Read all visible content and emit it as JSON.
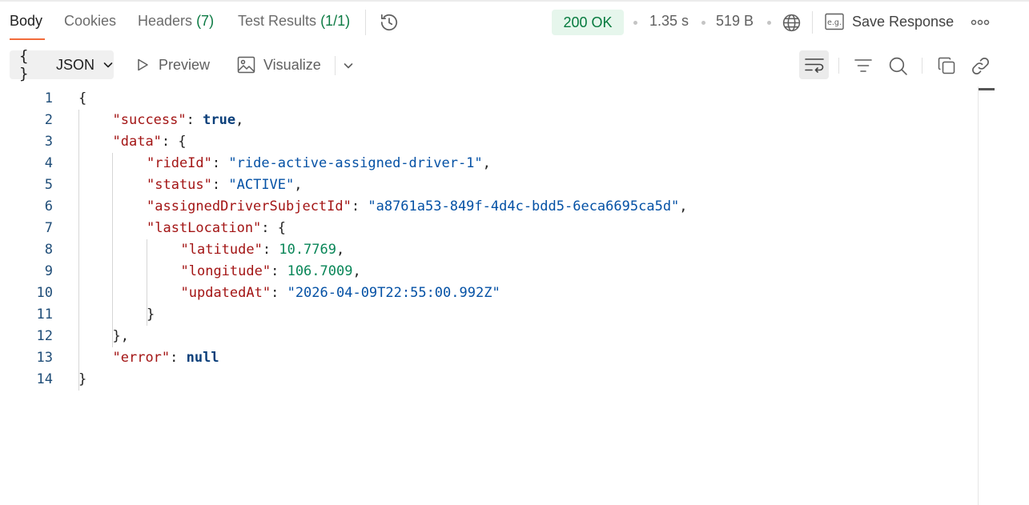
{
  "tabs": {
    "body": "Body",
    "cookies": "Cookies",
    "headers": "Headers",
    "headers_count": "(7)",
    "test_results": "Test Results",
    "test_results_count": "(1/1)"
  },
  "response": {
    "status": "200 OK",
    "time": "1.35 s",
    "size": "519 B",
    "save_label": "Save Response"
  },
  "toolbar": {
    "format_braces": "{ }",
    "format_label": "JSON",
    "preview_label": "Preview",
    "visualize_label": "Visualize"
  },
  "icons": {
    "history": "history-icon",
    "network": "globe-icon",
    "save": "example-icon",
    "more": "more-horizontal-icon",
    "wrap": "word-wrap-icon",
    "filter": "filter-icon",
    "search": "search-icon",
    "copy": "copy-icon",
    "link": "link-icon"
  },
  "colors": {
    "accent": "#f26b3a",
    "status_bg": "#e6f6ec",
    "status_text": "#067a3e",
    "json_key": "#a31515",
    "json_string": "#0451a5",
    "json_number": "#098658",
    "json_keyword": "#0b3f7a"
  },
  "code": {
    "lines": [
      {
        "num": "1",
        "parts": [
          {
            "t": "{",
            "c": "punct"
          }
        ]
      },
      {
        "num": "2",
        "parts": [
          {
            "t": "\"success\"",
            "c": "key"
          },
          {
            "t": ": ",
            "c": "punct"
          },
          {
            "t": "true",
            "c": "kw"
          },
          {
            "t": ",",
            "c": "punct"
          }
        ]
      },
      {
        "num": "3",
        "parts": [
          {
            "t": "\"data\"",
            "c": "key"
          },
          {
            "t": ": {",
            "c": "punct"
          }
        ]
      },
      {
        "num": "4",
        "parts": [
          {
            "t": "\"rideId\"",
            "c": "key"
          },
          {
            "t": ": ",
            "c": "punct"
          },
          {
            "t": "\"ride-active-assigned-driver-1\"",
            "c": "str"
          },
          {
            "t": ",",
            "c": "punct"
          }
        ]
      },
      {
        "num": "5",
        "parts": [
          {
            "t": "\"status\"",
            "c": "key"
          },
          {
            "t": ": ",
            "c": "punct"
          },
          {
            "t": "\"ACTIVE\"",
            "c": "str"
          },
          {
            "t": ",",
            "c": "punct"
          }
        ]
      },
      {
        "num": "6",
        "parts": [
          {
            "t": "\"assignedDriverSubjectId\"",
            "c": "key"
          },
          {
            "t": ": ",
            "c": "punct"
          },
          {
            "t": "\"a8761a53-849f-4d4c-bdd5-6eca6695ca5d\"",
            "c": "str"
          },
          {
            "t": ",",
            "c": "punct"
          }
        ]
      },
      {
        "num": "7",
        "parts": [
          {
            "t": "\"lastLocation\"",
            "c": "key"
          },
          {
            "t": ": {",
            "c": "punct"
          }
        ]
      },
      {
        "num": "8",
        "parts": [
          {
            "t": "\"latitude\"",
            "c": "key"
          },
          {
            "t": ": ",
            "c": "punct"
          },
          {
            "t": "10.7769",
            "c": "num"
          },
          {
            "t": ",",
            "c": "punct"
          }
        ]
      },
      {
        "num": "9",
        "parts": [
          {
            "t": "\"longitude\"",
            "c": "key"
          },
          {
            "t": ": ",
            "c": "punct"
          },
          {
            "t": "106.7009",
            "c": "num"
          },
          {
            "t": ",",
            "c": "punct"
          }
        ]
      },
      {
        "num": "10",
        "parts": [
          {
            "t": "\"updatedAt\"",
            "c": "key"
          },
          {
            "t": ": ",
            "c": "punct"
          },
          {
            "t": "\"2026-04-09T22:55:00.992Z\"",
            "c": "str"
          }
        ]
      },
      {
        "num": "11",
        "parts": [
          {
            "t": "}",
            "c": "punct"
          }
        ]
      },
      {
        "num": "12",
        "parts": [
          {
            "t": "},",
            "c": "punct"
          }
        ]
      },
      {
        "num": "13",
        "parts": [
          {
            "t": "\"error\"",
            "c": "key"
          },
          {
            "t": ": ",
            "c": "punct"
          },
          {
            "t": "null",
            "c": "kw"
          }
        ]
      },
      {
        "num": "14",
        "parts": [
          {
            "t": "}",
            "c": "punct"
          }
        ]
      }
    ]
  }
}
